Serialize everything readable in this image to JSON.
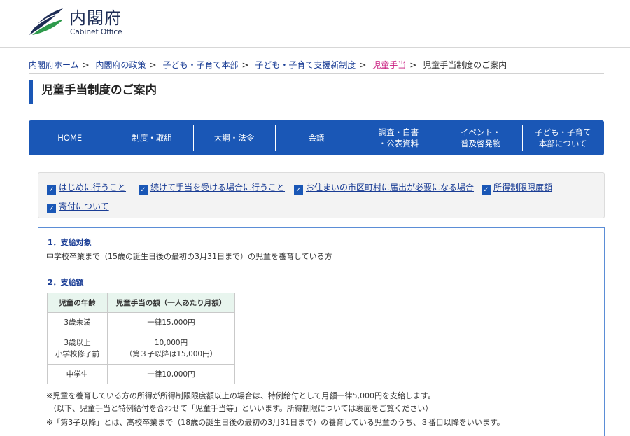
{
  "header": {
    "logo_ja": "内閣府",
    "logo_en": "Cabinet Office",
    "colors": {
      "brand_blue": "#1a57b6",
      "logo_green": "#2e9a4c",
      "link_blue": "#1a3d95",
      "link_pink": "#c8177d"
    }
  },
  "breadcrumb": {
    "items": [
      "内閣府ホーム",
      "内閣府の政策",
      "子ども・子育て本部",
      "子ども・子育て支援新制度",
      "児童手当"
    ],
    "current": "児童手当制度のご案内",
    "separator": ">"
  },
  "page_title": "児童手当制度のご案内",
  "gnav": {
    "items": [
      {
        "line1": "HOME",
        "line2": ""
      },
      {
        "line1": "制度・取組",
        "line2": ""
      },
      {
        "line1": "大綱・法令",
        "line2": ""
      },
      {
        "line1": "会議",
        "line2": ""
      },
      {
        "line1": "調査・白書",
        "line2": "・公表資料"
      },
      {
        "line1": "イベント・",
        "line2": "普及啓発物"
      },
      {
        "line1": "子ども・子育て",
        "line2": "本部について"
      }
    ]
  },
  "anchors": {
    "icon": "check-box-icon",
    "items": [
      "はじめに行うこと",
      "続けて手当を受ける場合に行うこと",
      "お住まいの市区町村に届出が必要になる場合",
      "所得制限限度額",
      "寄付について"
    ]
  },
  "content": {
    "section1_title": "1．支給対象",
    "section1_text": "中学校卒業まで（15歳の誕生日後の最初の3月31日まで）の児童を養育している方",
    "section2_title": "2．支給額",
    "table": {
      "headers": [
        "児童の年齢",
        "児童手当の額（一人あたり月額）"
      ],
      "rows": [
        {
          "age": [
            "3歳未満"
          ],
          "amount": [
            "一律15,000円"
          ]
        },
        {
          "age": [
            "3歳以上",
            "小学校修了前"
          ],
          "amount": [
            "10,000円",
            "（第３子以降は15,000円）"
          ]
        },
        {
          "age": [
            "中学生"
          ],
          "amount": [
            "一律10,000円"
          ]
        }
      ]
    },
    "notes": [
      "※児童を養育している方の所得が所得制限限度額以上の場合は、特例給付として月額一律5,000円を支給します。",
      "（以下、児童手当と特例給付を合わせて「児童手当等」といいます。所得制限については裏面をご覧ください）",
      "※「第3子以降」とは、高校卒業まで（18歳の誕生日後の最初の3月31日まで）の養育している児童のうち、３番目以降をいいます。"
    ]
  }
}
